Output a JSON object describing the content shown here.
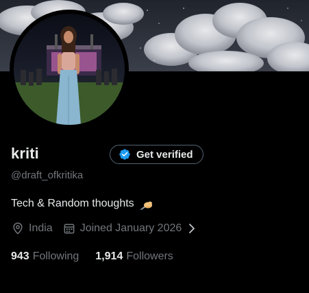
{
  "profile": {
    "name": "kriti",
    "handle": "@draft_ofkritika",
    "bio": "Tech & Random thoughts",
    "bio_emoji": "writing-hand-icon",
    "location": "India",
    "joined": "Joined January 2026"
  },
  "verify": {
    "label": "Get verified"
  },
  "stats": {
    "following_count": "943",
    "following_label": "Following",
    "followers_count": "1,914",
    "followers_label": "Followers"
  },
  "colors": {
    "background": "#000000",
    "primary_text": "#e7e9ea",
    "secondary_text": "#71767b",
    "verified_badge": "#1d9bf0",
    "button_border": "#536471"
  }
}
